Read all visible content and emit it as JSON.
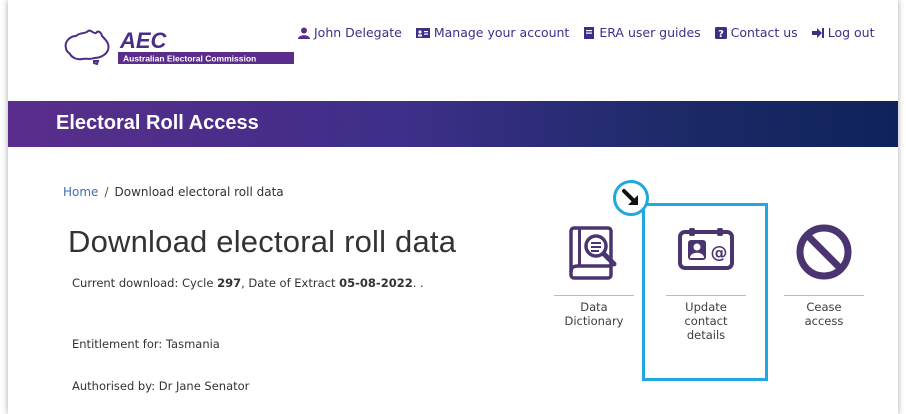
{
  "header": {
    "logo_text": "AEC",
    "logo_subtitle": "Australian Electoral Commission",
    "nav": [
      {
        "label": "John Delegate",
        "icon": "user-icon"
      },
      {
        "label": "Manage your account",
        "icon": "id-card-icon"
      },
      {
        "label": "ERA user guides",
        "icon": "book-icon"
      },
      {
        "label": "Contact us",
        "icon": "question-icon"
      },
      {
        "label": "Log out",
        "icon": "sign-out-icon"
      }
    ]
  },
  "banner": {
    "title": "Electoral Roll Access"
  },
  "breadcrumb": {
    "home": "Home",
    "separator": "/",
    "current": "Download electoral roll data"
  },
  "page": {
    "title": "Download electoral roll data",
    "current_prefix": "Current download: Cycle ",
    "cycle": "297",
    "extract_prefix": ", Date of Extract ",
    "extract_date": "05-08-2022",
    "current_suffix": ". .",
    "entitlement": "Entitlement for: Tasmania",
    "authorised": "Authorised by: Dr Jane Senator"
  },
  "actions": [
    {
      "label_lines": [
        "Data",
        "Dictionary"
      ],
      "icon": "data-dictionary-icon"
    },
    {
      "label_lines": [
        "Update",
        "contact",
        "details"
      ],
      "icon": "contact-card-icon",
      "highlighted": true
    },
    {
      "label_lines": [
        "Cease",
        "access"
      ],
      "icon": "prohibited-icon"
    }
  ],
  "colors": {
    "brand_purple": "#5a2d8c",
    "brand_navy": "#0f2259",
    "highlight_blue": "#1fa9df",
    "link_blue": "#3d6fb3"
  }
}
